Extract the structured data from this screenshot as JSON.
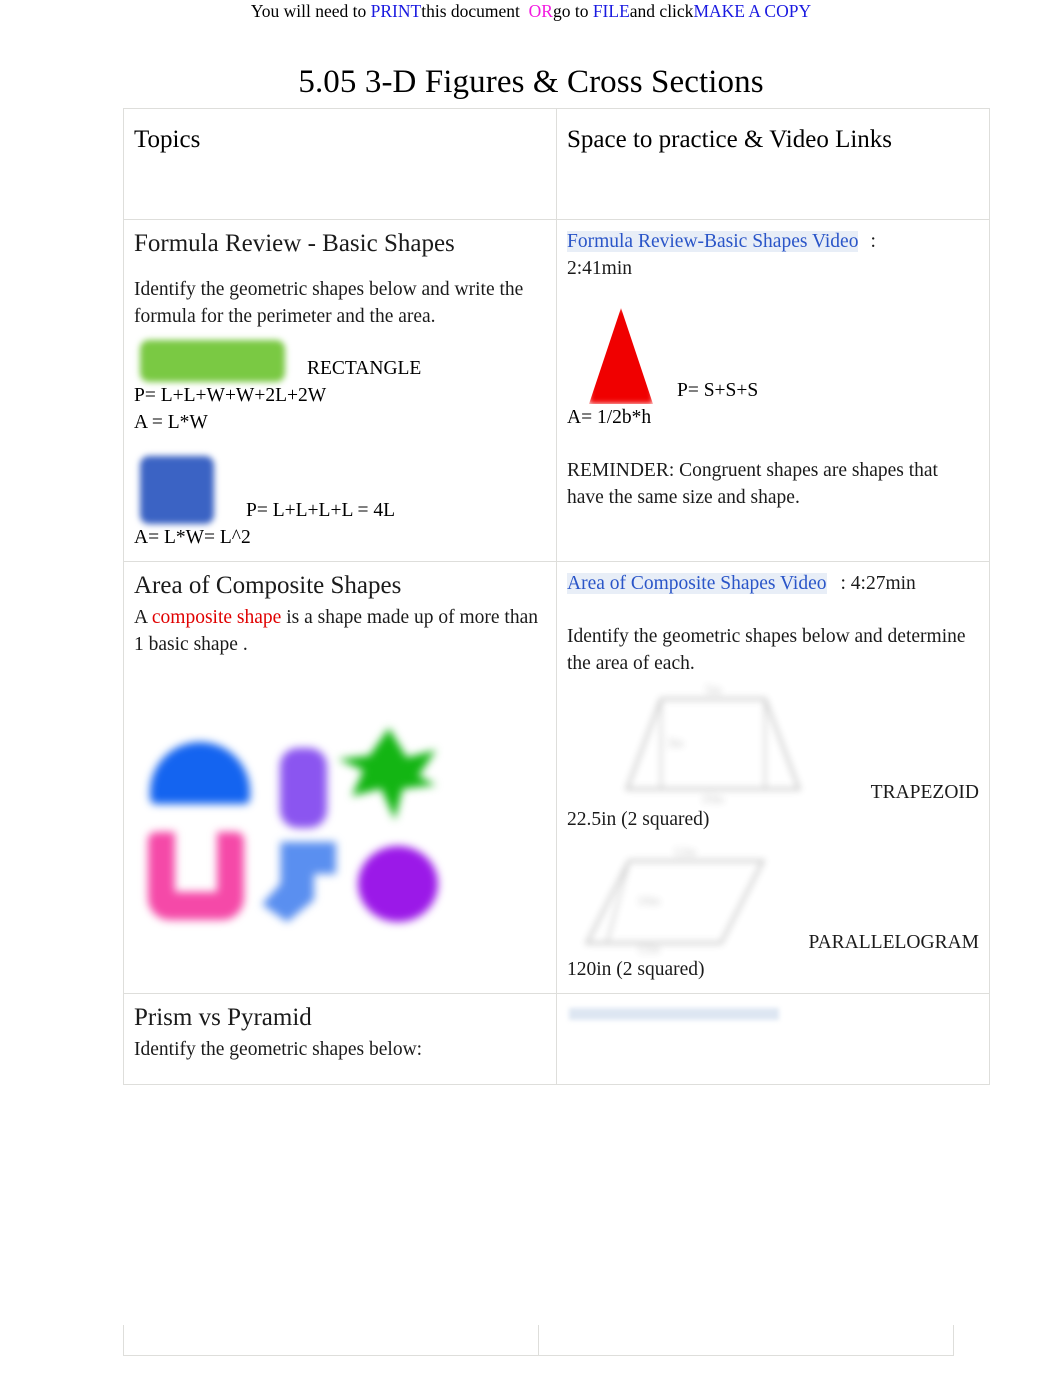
{
  "banner": {
    "parts": [
      {
        "text": "You will need to ",
        "color": "black"
      },
      {
        "text": "PRINT",
        "color": "blue"
      },
      {
        "text": "this document  ",
        "color": "black"
      },
      {
        "text": "OR",
        "color": "magenta"
      },
      {
        "text": "go to ",
        "color": "black"
      },
      {
        "text": "FILE",
        "color": "blue"
      },
      {
        "text": "and click",
        "color": "black"
      },
      {
        "text": "MAKE A COPY",
        "color": "blue"
      }
    ]
  },
  "title": "5.05 3-D Figures & Cross Sections",
  "table": {
    "headers": {
      "left": "Topics",
      "right": "Space to practice & Video Links"
    },
    "rows": [
      {
        "left": {
          "heading": "Formula Review - Basic Shapes",
          "intro": "Identify the geometric shapes below and write the formula for the perimeter and the area.",
          "rectangle_label": "RECTANGLE",
          "rectangle_perimeter": "P= L+L+W+W+2L+2W",
          "rectangle_area": "A = L*W",
          "square_perimeter": "P= L+L+L+L = 4L",
          "square_area": "A= L*W= L^2",
          "shapes": [
            "green-rectangle",
            "blue-square"
          ]
        },
        "right": {
          "link_text": "Formula Review-Basic Shapes Video",
          "link_suffix": ":",
          "duration": "2:41min",
          "triangle_perimeter": "P= S+S+S",
          "triangle_area": "A= 1/2b*h",
          "reminder": "REMINDER:   Congruent shapes are shapes that have the same   size and  shape.",
          "shapes": [
            "red-triangle"
          ]
        }
      },
      {
        "left": {
          "heading": "Area of Composite Shapes",
          "definition_prefix": "A ",
          "definition_term": "composite shape",
          "definition_suffix": " is a shape made up of more than 1 basic shape .",
          "shapes": [
            "blue-dome",
            "purple-pill",
            "green-star",
            "pink-u",
            "blue-arrow",
            "purple-circle"
          ]
        },
        "right": {
          "link_text": "Area of Composite Shapes Video",
          "link_suffix": ": 4:27min",
          "instruction": "Identify the geometric shapes below and determine the area of each.",
          "trapezoid_label": "TRAPEZOID",
          "trapezoid_answer": "22.5in (2 squared)",
          "parallelogram_label": "PARALLELOGRAM",
          "parallelogram_answer": "120in (2 squared)",
          "shapes": [
            "trapezoid-outline",
            "parallelogram-outline"
          ]
        }
      },
      {
        "left": {
          "heading": "Prism vs Pyramid",
          "instruction": "Identify the geometric shapes below:"
        },
        "right": {
          "ghost_link": ""
        }
      }
    ]
  },
  "colors": {
    "link": "#2a55c8",
    "link_highlight": "#e8eef7",
    "accent_red": "#e00000",
    "banner_blue": "#1a1ae0",
    "banner_magenta": "#f31ae0",
    "border": "#dededb",
    "green_rectangle": "#7ac943",
    "blue_square": "#3b63c4",
    "red_triangle": "#f00000",
    "blue_dome": "#1464f0",
    "purple_pill": "#8b55f0",
    "green_star": "#13b513",
    "pink_u": "#f549a8",
    "blue_arrow": "#5a8ff0",
    "purple_circle": "#9b19e8"
  }
}
